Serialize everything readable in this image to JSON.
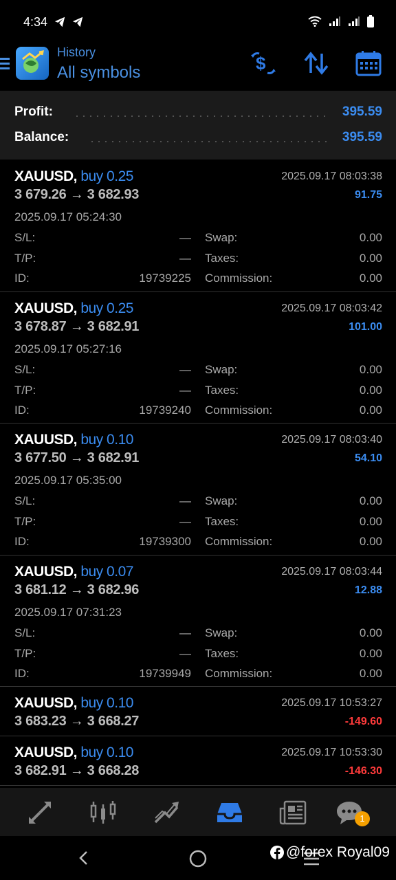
{
  "status_bar": {
    "time": "4:34"
  },
  "header": {
    "subtitle": "History",
    "title": "All symbols"
  },
  "summary": {
    "profit_label": "Profit:",
    "profit_value": "395.59",
    "balance_label": "Balance:",
    "balance_value": "395.59"
  },
  "labels": {
    "sl": "S/L:",
    "tp": "T/P:",
    "id": "ID:",
    "swap": "Swap:",
    "taxes": "Taxes:",
    "commission": "Commission:"
  },
  "deals": [
    {
      "symbol": "XAUUSD,",
      "type": "buy 0.25",
      "close_time": "2025.09.17 08:03:38",
      "prices": "3 679.26 → 3 682.93",
      "profit": "91.75",
      "open_time": "2025.09.17 05:24:30",
      "sl": "—",
      "tp": "—",
      "id": "19739225",
      "swap": "0.00",
      "taxes": "0.00",
      "commission": "0.00"
    },
    {
      "symbol": "XAUUSD,",
      "type": "buy 0.25",
      "close_time": "2025.09.17 08:03:42",
      "prices": "3 678.87 → 3 682.91",
      "profit": "101.00",
      "open_time": "2025.09.17 05:27:16",
      "sl": "—",
      "tp": "—",
      "id": "19739240",
      "swap": "0.00",
      "taxes": "0.00",
      "commission": "0.00"
    },
    {
      "symbol": "XAUUSD,",
      "type": "buy 0.10",
      "close_time": "2025.09.17 08:03:40",
      "prices": "3 677.50 → 3 682.91",
      "profit": "54.10",
      "open_time": "2025.09.17 05:35:00",
      "sl": "—",
      "tp": "—",
      "id": "19739300",
      "swap": "0.00",
      "taxes": "0.00",
      "commission": "0.00"
    },
    {
      "symbol": "XAUUSD,",
      "type": "buy 0.07",
      "close_time": "2025.09.17 08:03:44",
      "prices": "3 681.12 → 3 682.96",
      "profit": "12.88",
      "open_time": "2025.09.17 07:31:23",
      "sl": "—",
      "tp": "—",
      "id": "19739949",
      "swap": "0.00",
      "taxes": "0.00",
      "commission": "0.00"
    },
    {
      "symbol": "XAUUSD,",
      "type": "buy 0.10",
      "close_time": "2025.09.17 10:53:27",
      "prices": "3 683.23 → 3 668.27",
      "profit": "-149.60"
    },
    {
      "symbol": "XAUUSD,",
      "type": "buy 0.10",
      "close_time": "2025.09.17 10:53:30",
      "prices": "3 682.91 → 3 668.28",
      "profit": "-146.30"
    }
  ],
  "bottom_nav": {
    "active": "history",
    "chat_badge": "1"
  },
  "watermark": "@forex Royal09",
  "colors": {
    "accent": "#3b8cf0",
    "loss": "#ff3b3b",
    "badge": "#f5a000"
  }
}
